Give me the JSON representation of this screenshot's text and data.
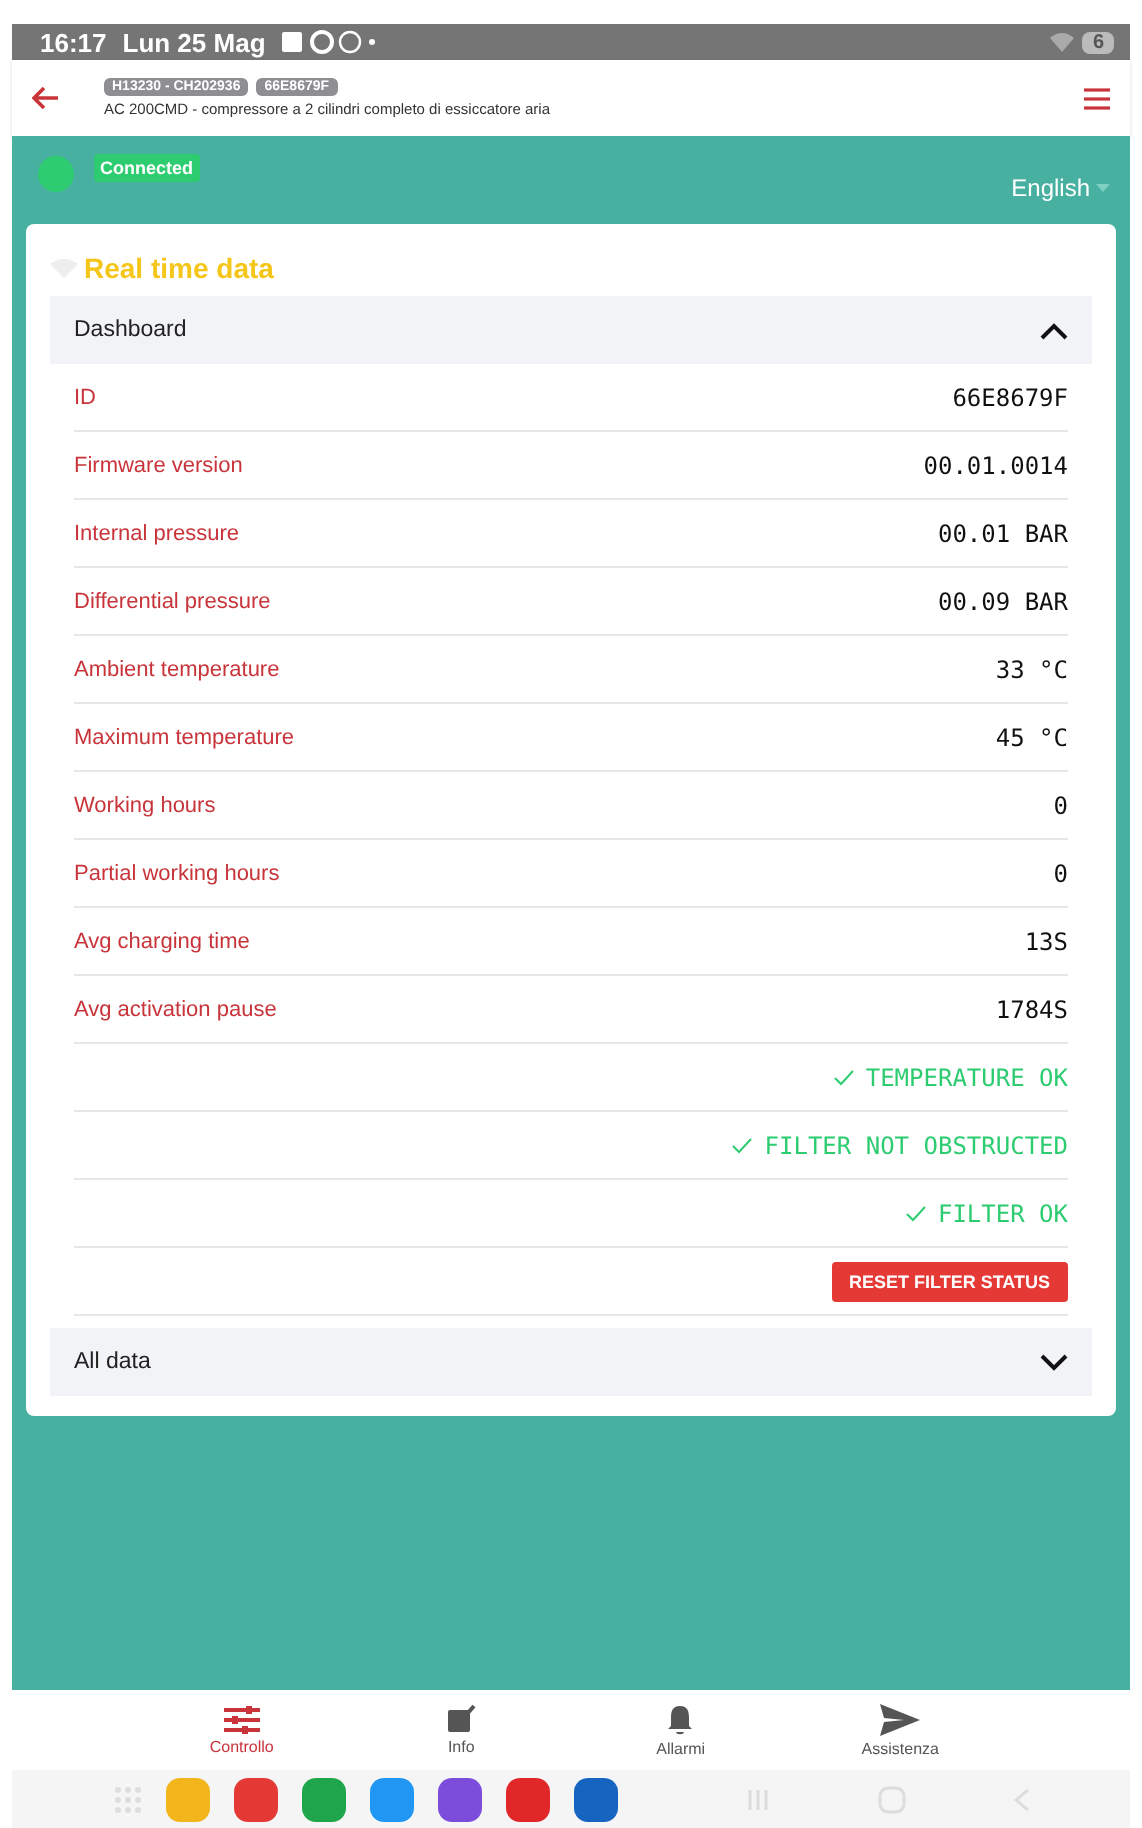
{
  "status_bar": {
    "time": "16:17",
    "date": "Lun 25 Mag",
    "battery": "6"
  },
  "header": {
    "tags": [
      "H13230 - CH202936",
      "66E8679F"
    ],
    "subtitle": "AC 200CMD - compressore a 2 cilindri completo di essiccatore aria"
  },
  "connection": {
    "label": "Connected",
    "connected": true,
    "language": "English"
  },
  "card": {
    "title": "Real time data",
    "dashboard": {
      "title": "Dashboard",
      "expanded": true,
      "rows": [
        {
          "label": "ID",
          "value": "66E8679F"
        },
        {
          "label": "Firmware version",
          "value": "00.01.0014"
        },
        {
          "label": "Internal pressure",
          "value": "00.01 BAR"
        },
        {
          "label": "Differential pressure",
          "value": "00.09 BAR"
        },
        {
          "label": "Ambient temperature",
          "value": "33 °C"
        },
        {
          "label": "Maximum temperature",
          "value": "45 °C"
        },
        {
          "label": "Working hours",
          "value": "0"
        },
        {
          "label": "Partial working hours",
          "value": "0"
        },
        {
          "label": "Avg charging time",
          "value": "13S"
        },
        {
          "label": "Avg activation pause",
          "value": "1784S"
        }
      ],
      "statuses": [
        {
          "text": "TEMPERATURE OK",
          "ok": true
        },
        {
          "text": "FILTER NOT OBSTRUCTED",
          "ok": true
        },
        {
          "text": "FILTER OK",
          "ok": true
        }
      ],
      "button": "RESET FILTER STATUS"
    },
    "all_data": {
      "title": "All data",
      "expanded": false
    }
  },
  "nav": [
    {
      "label": "Controllo",
      "selected": true,
      "kind": "sliders"
    },
    {
      "label": "Info",
      "selected": false,
      "kind": "edit"
    },
    {
      "label": "Allarmi",
      "selected": false,
      "kind": "bell"
    },
    {
      "label": "Assistenza",
      "selected": false,
      "kind": "send"
    }
  ],
  "dock": [
    {
      "color": "#f2b61c"
    },
    {
      "color": "#e53935"
    },
    {
      "color": "#1fa64a"
    },
    {
      "color": "#2196f3"
    },
    {
      "color": "#7c4ddb"
    },
    {
      "color": "#e02828"
    },
    {
      "color": "#1565c0"
    }
  ]
}
